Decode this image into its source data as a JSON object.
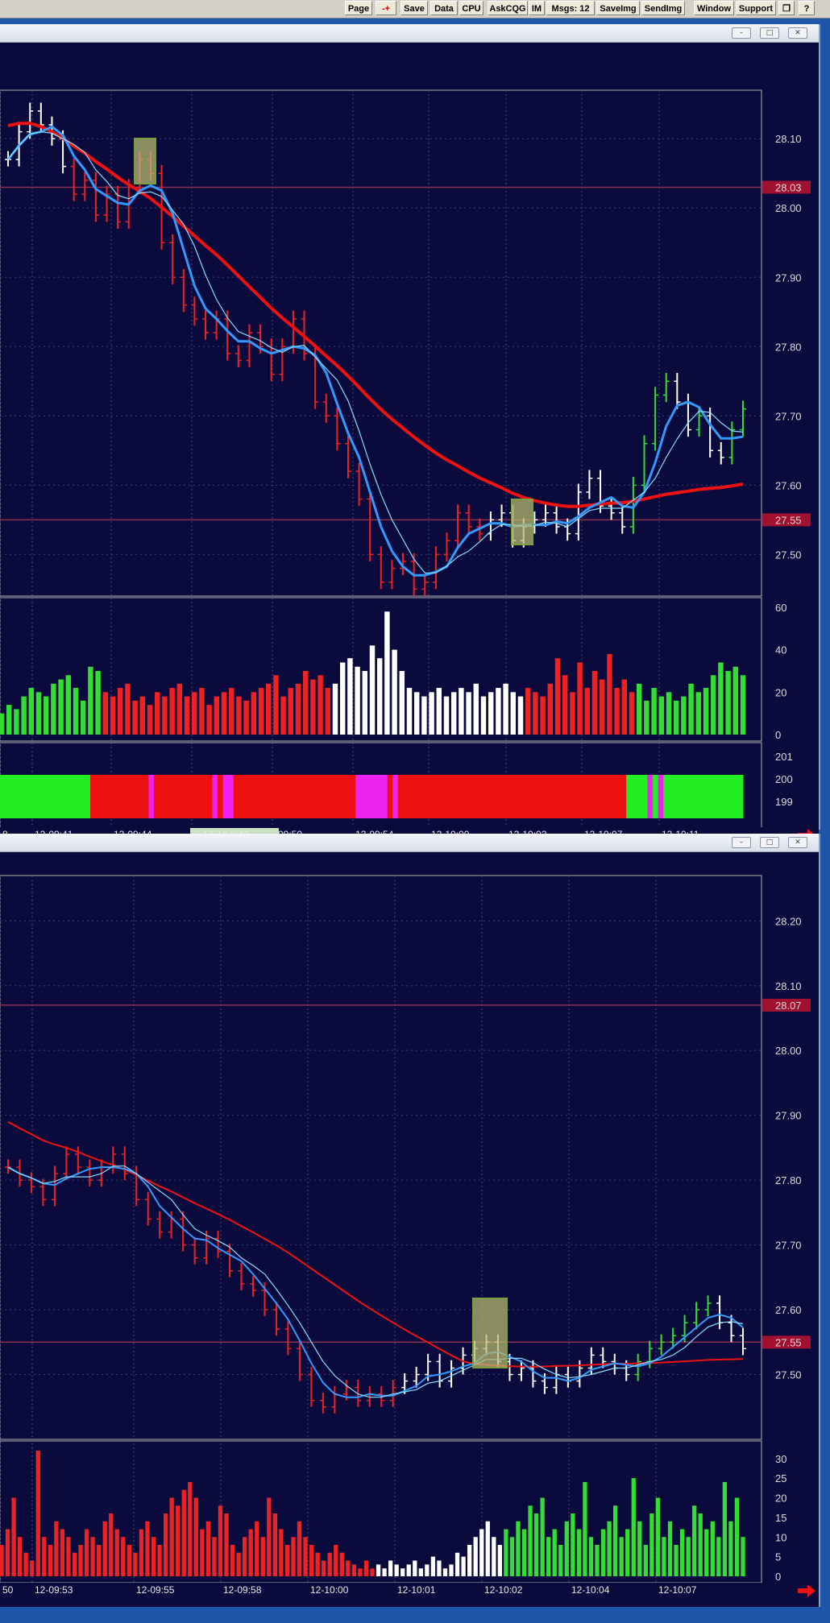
{
  "toolbar": {
    "buttons": [
      "Page",
      "-+",
      "Save",
      "Data",
      "CPU",
      "AskCQG",
      "IM",
      "Msgs: 12",
      "SaveImg",
      "SendImg",
      "Window",
      "Support",
      "?"
    ]
  },
  "colors": {
    "background": "#0a0a3c",
    "bull": "#33dd33",
    "bear": "#ee2222",
    "neutral": "#ffffff",
    "ma_slow": "#ee1111",
    "ma_fast": "#3399ff",
    "ma_thin": "#88ddff"
  },
  "chart_data": [
    {
      "type": "candlestick",
      "price_axis": {
        "ticks": [
          "28.10",
          "28.00",
          "27.90",
          "27.80",
          "27.70",
          "27.60",
          "27.50"
        ],
        "ylim": [
          27.44,
          28.17
        ]
      },
      "markers": [
        {
          "value": 28.03,
          "label": "28.03"
        },
        {
          "value": 27.55,
          "label": "27.55"
        }
      ],
      "volume_axis": {
        "ticks": [
          "60",
          "40",
          "20",
          "0"
        ],
        "ylim": [
          0,
          60
        ]
      },
      "indicator_axis": {
        "ticks": [
          "201",
          "200",
          "199"
        ]
      },
      "time_labels": [
        "8",
        "12-09:41",
        "12-09:44",
        "2-12-16 9:49",
        "-09:50",
        "12-09:54",
        "12-10:00",
        "12-10:02",
        "12-10:07",
        "12-10:11"
      ],
      "ohlc_close": [
        28.07,
        28.11,
        28.14,
        28.12,
        28.1,
        28.06,
        28.02,
        28.04,
        27.99,
        28.02,
        27.98,
        28.03,
        28.07,
        28.05,
        27.95,
        27.9,
        27.86,
        27.84,
        27.82,
        27.84,
        27.79,
        27.78,
        27.82,
        27.8,
        27.76,
        27.8,
        27.84,
        27.79,
        27.72,
        27.7,
        27.66,
        27.62,
        27.58,
        27.5,
        27.46,
        27.48,
        27.49,
        27.45,
        27.46,
        27.5,
        27.52,
        27.56,
        27.54,
        27.53,
        27.55,
        27.56,
        27.52,
        27.54,
        27.55,
        27.56,
        27.54,
        27.53,
        27.59,
        27.61,
        27.57,
        27.56,
        27.54,
        27.6,
        27.66,
        27.73,
        27.75,
        27.72,
        27.68,
        27.7,
        27.65,
        27.64,
        27.68,
        27.71
      ],
      "volume": [
        10,
        14,
        12,
        18,
        22,
        20,
        18,
        24,
        26,
        28,
        22,
        16,
        32,
        30,
        20,
        18,
        22,
        24,
        16,
        18,
        14,
        20,
        18,
        22,
        24,
        18,
        20,
        22,
        14,
        18,
        20,
        22,
        18,
        16,
        20,
        22,
        24,
        28,
        18,
        22,
        24,
        30,
        26,
        28,
        22,
        24,
        34,
        36,
        32,
        30,
        42,
        36,
        58,
        40,
        30,
        22,
        20,
        18,
        20,
        22,
        18,
        20,
        22,
        20,
        24,
        18,
        20,
        22,
        24,
        20,
        18,
        22,
        20,
        18,
        24,
        36,
        28,
        20,
        34,
        22,
        30,
        26,
        38,
        22,
        26,
        20,
        24,
        16,
        22,
        18,
        20,
        16,
        18,
        24,
        20,
        22,
        28,
        34,
        30,
        32,
        28
      ],
      "indicator_colors": [
        "g",
        "g",
        "g",
        "g",
        "g",
        "g",
        "g",
        "g",
        "g",
        "g",
        "g",
        "g",
        "g",
        "g",
        "g",
        "g",
        "g",
        "r",
        "r",
        "r",
        "r",
        "r",
        "r",
        "r",
        "r",
        "r",
        "r",
        "r",
        "m",
        "r",
        "r",
        "r",
        "r",
        "r",
        "r",
        "r",
        "r",
        "r",
        "r",
        "r",
        "m",
        "r",
        "m",
        "m",
        "r",
        "r",
        "r",
        "r",
        "r",
        "r",
        "r",
        "r",
        "r",
        "r",
        "r",
        "r",
        "r",
        "r",
        "r",
        "r",
        "r",
        "r",
        "r",
        "r",
        "r",
        "r",
        "r",
        "m",
        "m",
        "m",
        "m",
        "m",
        "m",
        "r",
        "m",
        "r",
        "r",
        "r",
        "r",
        "r",
        "r",
        "r",
        "r",
        "r",
        "r",
        "r",
        "r",
        "r",
        "r",
        "r",
        "r",
        "r",
        "r",
        "r",
        "r",
        "r",
        "r",
        "r",
        "r",
        "r",
        "r",
        "r",
        "r",
        "r",
        "r",
        "r",
        "r",
        "r",
        "r",
        "r",
        "r",
        "r",
        "r",
        "r",
        "r",
        "r",
        "r",
        "r",
        "g",
        "g",
        "g",
        "g",
        "m",
        "g",
        "m",
        "g",
        "g",
        "g",
        "g",
        "g",
        "g",
        "g",
        "g",
        "g",
        "g",
        "g",
        "g",
        "g",
        "g",
        "g"
      ]
    },
    {
      "type": "candlestick",
      "price_axis": {
        "ticks": [
          "28.20",
          "28.10",
          "28.00",
          "27.90",
          "27.80",
          "27.70",
          "27.60",
          "27.50"
        ],
        "ylim": [
          27.4,
          28.27
        ]
      },
      "markers": [
        {
          "value": 28.07,
          "label": "28.07"
        },
        {
          "value": 27.55,
          "label": "27.55"
        }
      ],
      "volume_axis": {
        "ticks": [
          "30",
          "25",
          "20",
          "15",
          "10",
          "5",
          "0"
        ],
        "ylim": [
          0,
          32
        ]
      },
      "time_labels": [
        "50",
        "12-09:53",
        "12-09:55",
        "12-09:58",
        "12-10:00",
        "12-10:01",
        "12-10:02",
        "12-10:04",
        "12-10:07"
      ],
      "ohlc_close": [
        27.82,
        27.8,
        27.79,
        27.77,
        27.81,
        27.84,
        27.82,
        27.8,
        27.82,
        27.84,
        27.81,
        27.77,
        27.74,
        27.72,
        27.74,
        27.7,
        27.68,
        27.71,
        27.69,
        27.66,
        27.64,
        27.63,
        27.6,
        27.57,
        27.54,
        27.5,
        27.46,
        27.45,
        27.47,
        27.48,
        27.46,
        27.47,
        27.46,
        27.48,
        27.49,
        27.5,
        27.52,
        27.49,
        27.51,
        27.53,
        27.54,
        27.55,
        27.52,
        27.5,
        27.51,
        27.49,
        27.48,
        27.5,
        27.49,
        27.51,
        27.53,
        27.52,
        27.51,
        27.5,
        27.52,
        27.54,
        27.55,
        27.56,
        27.58,
        27.6,
        27.61,
        27.58,
        27.56,
        27.54
      ],
      "volume": [
        8,
        12,
        20,
        10,
        6,
        4,
        32,
        10,
        8,
        14,
        12,
        10,
        6,
        8,
        12,
        10,
        8,
        14,
        16,
        12,
        10,
        8,
        6,
        12,
        14,
        10,
        8,
        16,
        20,
        18,
        22,
        24,
        20,
        12,
        14,
        10,
        18,
        16,
        8,
        6,
        10,
        12,
        14,
        10,
        20,
        16,
        12,
        8,
        10,
        14,
        10,
        8,
        6,
        4,
        6,
        8,
        6,
        4,
        3,
        2,
        4,
        2,
        3,
        2,
        4,
        3,
        2,
        3,
        4,
        2,
        3,
        5,
        4,
        2,
        3,
        6,
        5,
        8,
        10,
        12,
        14,
        10,
        8,
        12,
        10,
        14,
        12,
        18,
        16,
        20,
        10,
        12,
        8,
        14,
        16,
        12,
        24,
        10,
        8,
        12,
        14,
        18,
        10,
        12,
        25,
        14,
        8,
        16,
        20,
        10,
        14,
        8,
        12,
        10,
        18,
        16,
        12,
        14,
        10,
        24,
        14,
        20,
        10
      ]
    }
  ]
}
